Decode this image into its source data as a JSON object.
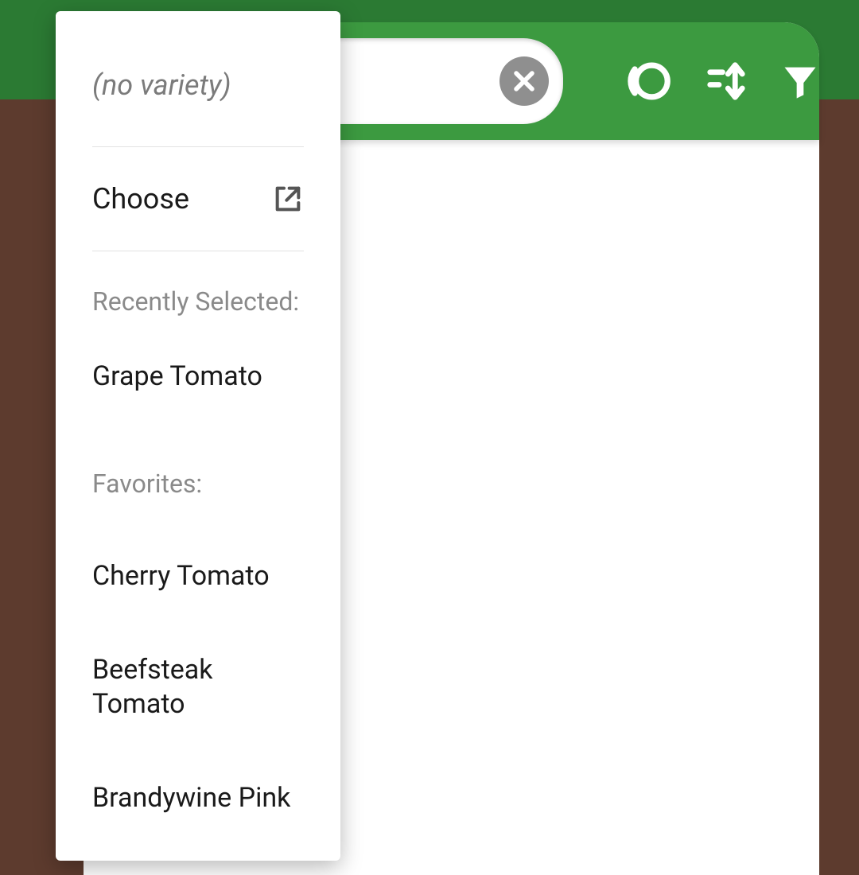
{
  "dropdown": {
    "no_variety_label": "(no variety)",
    "choose_label": "Choose",
    "recently_selected_label": "Recently Selected:",
    "recent_items": [
      "Grape Tomato"
    ],
    "favorites_label": "Favorites:",
    "favorite_items": [
      "Cherry Tomato",
      "Beefsteak Tomato",
      "Brandywine Pink"
    ]
  },
  "search": {
    "value": "",
    "placeholder": ""
  },
  "icons": {
    "clear": "close-circle",
    "view": "circle-ring",
    "sort": "sort-up-down",
    "filter": "funnel-filter",
    "open": "open-external"
  },
  "colors": {
    "header_green": "#3c9a40",
    "topbar_green": "#2b7a33",
    "bg_brown": "#5d3b2e",
    "muted_gray": "#8a8a8a"
  }
}
